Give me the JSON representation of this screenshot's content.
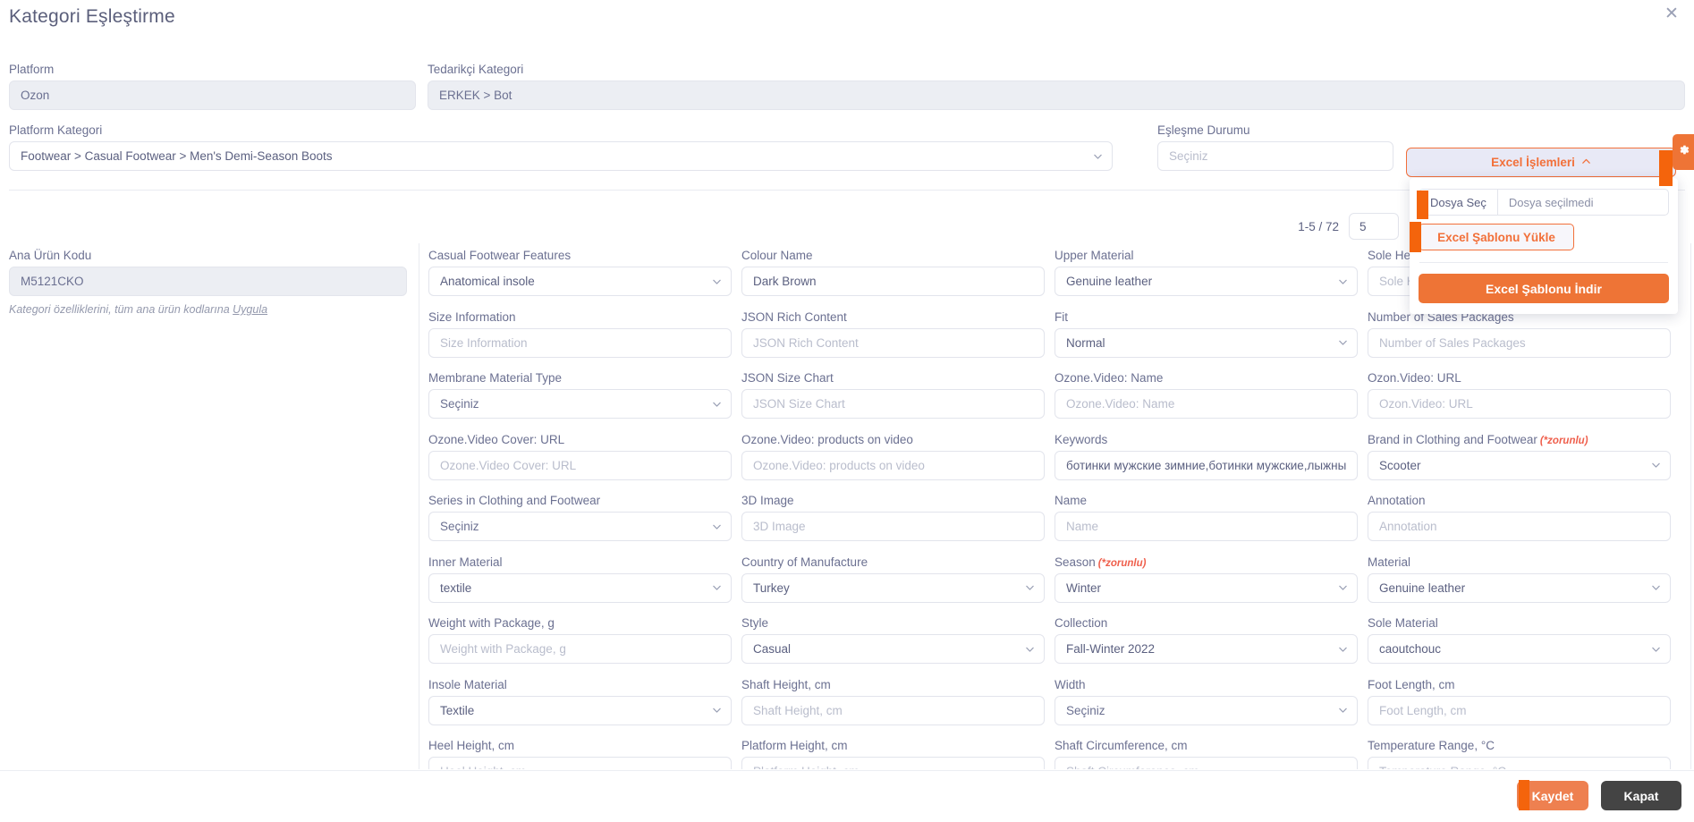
{
  "modal": {
    "title": "Kategori Eşleştirme",
    "close_icon": "close-icon"
  },
  "top_form": {
    "platform": {
      "label": "Platform",
      "value": "Ozon"
    },
    "supplier_category": {
      "label": "Tedarikçi Kategori",
      "value": "ERKEK > Bot"
    },
    "platform_category": {
      "label": "Platform Kategori",
      "value": "Footwear > Casual Footwear > Men's Demi-Season Boots"
    },
    "match_status": {
      "label": "Eşleşme Durumu",
      "value": "Seçiniz"
    }
  },
  "pagination": {
    "range": "1-5 / 72",
    "page_size": "5"
  },
  "excel": {
    "button_label": "Excel İşlemleri",
    "chevron": "chevron-up-icon",
    "file_select_label": "Dosya Seç",
    "file_name": "Dosya seçilmedi",
    "upload_label": "Excel Şablonu Yükle",
    "download_label": "Excel Şablonu İndir"
  },
  "settings_tab": {
    "icon": "gear-icon"
  },
  "product": {
    "label": "Ana Ürün Kodu",
    "value": "M5121CKO",
    "hint_text": "Kategori özelliklerini, tüm ana ürün kodlarına ",
    "hint_link": "Uygula"
  },
  "required_marker": "(*zorunlu)",
  "columns": [
    {
      "fields": [
        {
          "label": "Casual Footwear Features",
          "type": "select",
          "value": "Anatomical insole",
          "filled": true
        },
        {
          "label": "Size Information",
          "type": "input",
          "value": "",
          "placeholder": "Size Information",
          "filled": false
        },
        {
          "label": "Membrane Material Type",
          "type": "select",
          "value": "Seçiniz",
          "filled": false
        },
        {
          "label": "Ozone.Video Cover: URL",
          "type": "input",
          "value": "",
          "placeholder": "Ozone.Video Cover: URL",
          "filled": false
        },
        {
          "label": "Series in Clothing and Footwear",
          "type": "select",
          "value": "Seçiniz",
          "filled": false
        },
        {
          "label": "Inner Material",
          "type": "select",
          "value": "textile",
          "filled": true
        },
        {
          "label": "Weight with Package, g",
          "type": "input",
          "value": "",
          "placeholder": "Weight with Package, g",
          "filled": false
        },
        {
          "label": "Insole Material",
          "type": "select",
          "value": "Textile",
          "filled": true
        },
        {
          "label": "Heel Height, cm",
          "type": "input",
          "value": "",
          "placeholder": "Heel Height, cm",
          "filled": false
        }
      ]
    },
    {
      "fields": [
        {
          "label": "Colour Name",
          "type": "input",
          "value": "Dark Brown",
          "placeholder": "Colour Name",
          "filled": true
        },
        {
          "label": "JSON Rich Content",
          "type": "input",
          "value": "",
          "placeholder": "JSON Rich Content",
          "filled": false
        },
        {
          "label": "JSON Size Chart",
          "type": "input",
          "value": "",
          "placeholder": "JSON Size Chart",
          "filled": false
        },
        {
          "label": "Ozone.Video: products on video",
          "type": "input",
          "value": "",
          "placeholder": "Ozone.Video: products on video",
          "filled": false
        },
        {
          "label": "3D Image",
          "type": "input",
          "value": "",
          "placeholder": "3D Image",
          "filled": false
        },
        {
          "label": "Country of Manufacture",
          "type": "select",
          "value": "Turkey",
          "filled": true
        },
        {
          "label": "Style",
          "type": "select",
          "value": "Casual",
          "filled": true
        },
        {
          "label": "Shaft Height, cm",
          "type": "input",
          "value": "",
          "placeholder": "Shaft Height, cm",
          "filled": false
        },
        {
          "label": "Platform Height, cm",
          "type": "input",
          "value": "",
          "placeholder": "Platform Height, cm",
          "filled": false
        }
      ]
    },
    {
      "fields": [
        {
          "label": "Upper Material",
          "type": "select",
          "value": "Genuine leather",
          "filled": true
        },
        {
          "label": "Fit",
          "type": "select",
          "value": "Normal",
          "filled": true
        },
        {
          "label": "Ozone.Video: Name",
          "type": "input",
          "value": "",
          "placeholder": "Ozone.Video: Name",
          "filled": false
        },
        {
          "label": "Keywords",
          "type": "input",
          "value": "ботинки мужские зимние,ботинки мужские,лыжны",
          "placeholder": "Keywords",
          "filled": true
        },
        {
          "label": "Name",
          "type": "input",
          "value": "",
          "placeholder": "Name",
          "filled": false
        },
        {
          "label": "Season",
          "required": true,
          "type": "select",
          "value": "Winter",
          "filled": true
        },
        {
          "label": "Collection",
          "type": "select",
          "value": "Fall-Winter 2022",
          "filled": true
        },
        {
          "label": "Width",
          "type": "select",
          "value": "Seçiniz",
          "filled": false
        },
        {
          "label": "Shaft Circumference, cm",
          "type": "input",
          "value": "",
          "placeholder": "Shaft Circumference, cm",
          "filled": false
        }
      ]
    },
    {
      "fields": [
        {
          "label": "Sole Height, cm",
          "type": "input",
          "value": "",
          "placeholder": "Sole Height, cm",
          "filled": false
        },
        {
          "label": "Number of Sales Packages",
          "type": "input",
          "value": "",
          "placeholder": "Number of Sales Packages",
          "filled": false
        },
        {
          "label": "Ozon.Video: URL",
          "type": "input",
          "value": "",
          "placeholder": "Ozon.Video: URL",
          "filled": false
        },
        {
          "label": "Brand in Clothing and Footwear",
          "required": true,
          "type": "select",
          "value": "Scooter",
          "filled": true
        },
        {
          "label": "Annotation",
          "type": "input",
          "value": "",
          "placeholder": "Annotation",
          "filled": false
        },
        {
          "label": "Material",
          "type": "select",
          "value": "Genuine leather",
          "filled": true
        },
        {
          "label": "Sole Material",
          "type": "select",
          "value": "caoutchouc",
          "filled": true
        },
        {
          "label": "Foot Length, cm",
          "type": "input",
          "value": "",
          "placeholder": "Foot Length, cm",
          "filled": false
        },
        {
          "label": "Temperature Range, °C",
          "type": "input",
          "value": "",
          "placeholder": "Temperature Range, °C",
          "filled": false
        }
      ]
    }
  ],
  "footer": {
    "save_label": "Kaydet",
    "close_label": "Kapat"
  },
  "colors": {
    "accent": "#ee7436",
    "scrollbar": "#f4640c",
    "required": "#ef5f4c",
    "dark_button": "#444444"
  }
}
